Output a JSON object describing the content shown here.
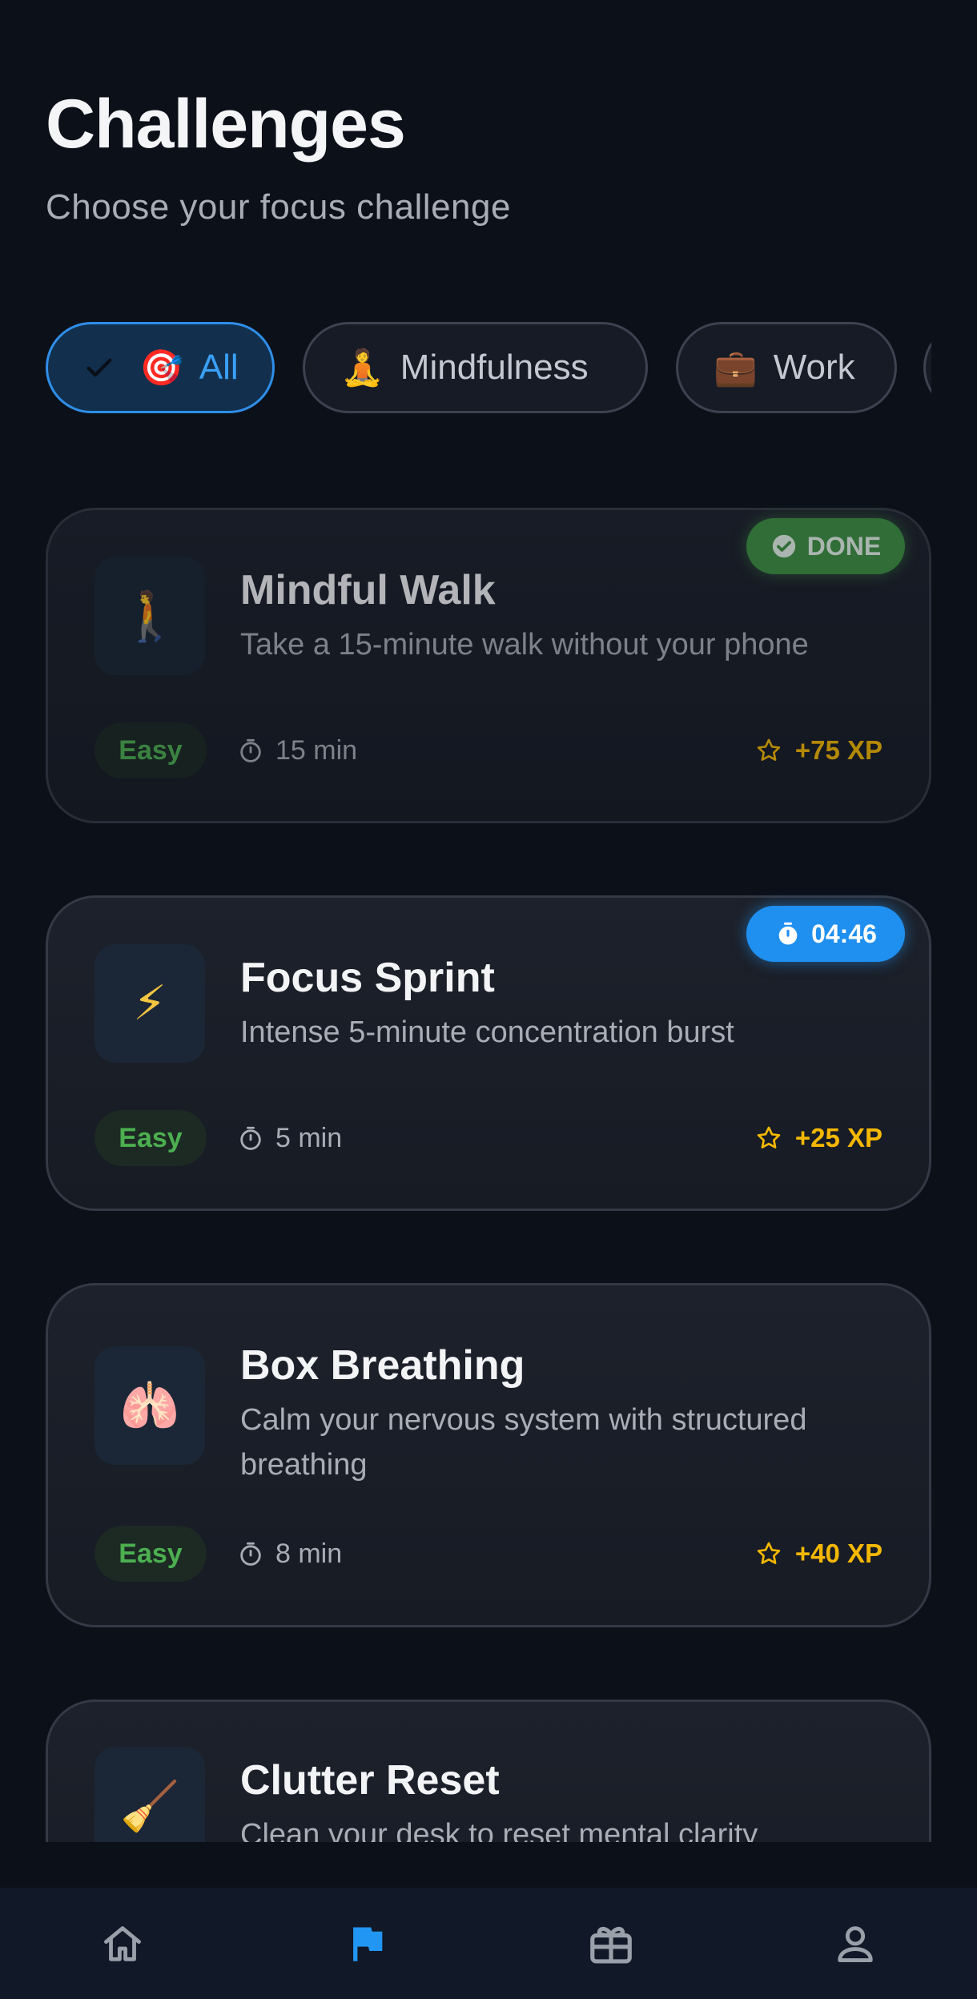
{
  "header": {
    "title": "Challenges",
    "subtitle": "Choose your focus challenge"
  },
  "filters": [
    {
      "emoji": "🎯",
      "label": "All",
      "selected": true
    },
    {
      "emoji": "🧘",
      "label": "Mindfulness",
      "selected": false
    },
    {
      "emoji": "💼",
      "label": "Work",
      "selected": false
    }
  ],
  "challenges": [
    {
      "icon": "🚶",
      "title": "Mindful Walk",
      "description": "Take a 15-minute walk without your phone",
      "difficulty": "Easy",
      "duration": "15 min",
      "xp": "+75 XP",
      "badge": "DONE"
    },
    {
      "icon": "⚡",
      "title": "Focus Sprint",
      "description": "Intense 5-minute concentration burst",
      "difficulty": "Easy",
      "duration": "5 min",
      "xp": "+25 XP",
      "badge": "04:46"
    },
    {
      "icon": "🫁",
      "title": "Box Breathing",
      "description": "Calm your nervous system with structured breathing",
      "difficulty": "Easy",
      "duration": "8 min",
      "xp": "+40 XP"
    },
    {
      "icon": "🧹",
      "title": "Clutter Reset",
      "description": "Clean your desk to reset mental clarity"
    }
  ],
  "nav": [
    {
      "icon": "home-icon",
      "active": false
    },
    {
      "icon": "flag-icon",
      "active": true
    },
    {
      "icon": "gift-icon",
      "active": false
    },
    {
      "icon": "profile-icon",
      "active": false
    }
  ],
  "colors": {
    "accent": "#2196f3",
    "easy": "#4caf50",
    "xp": "#f5b800",
    "done": "#3f9143",
    "background": "#0c1019"
  }
}
